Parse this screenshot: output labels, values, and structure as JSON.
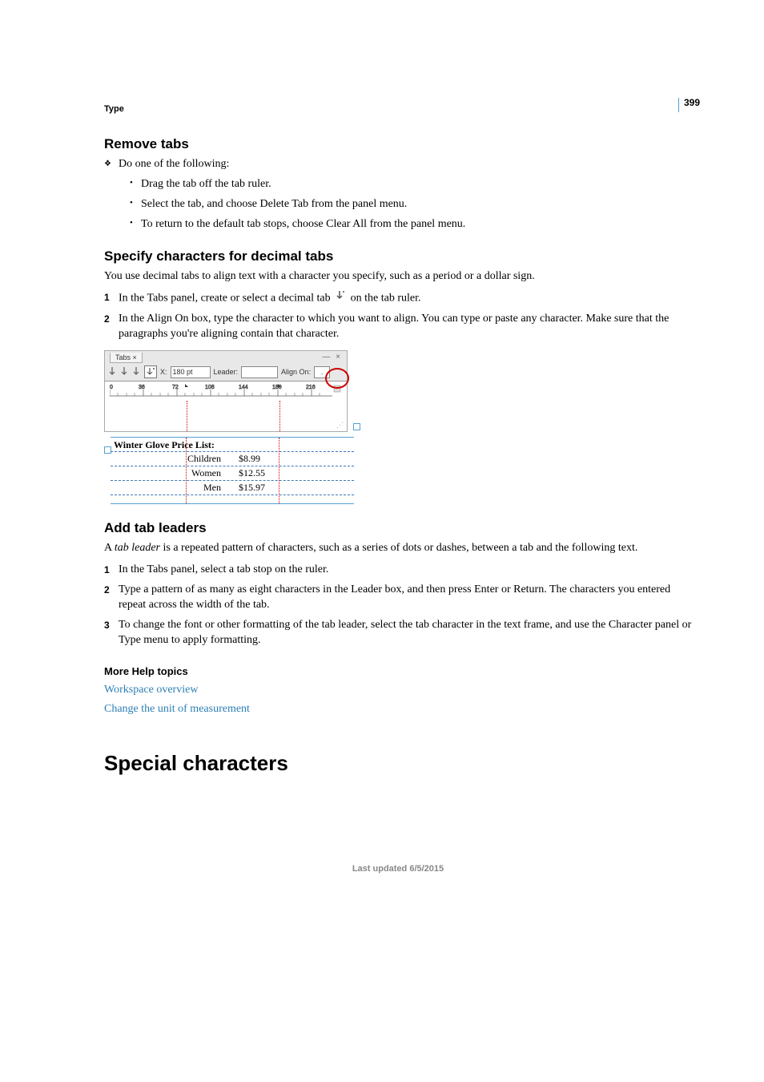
{
  "page_number": "399",
  "chapter": "Type",
  "section_remove": {
    "title": "Remove tabs",
    "intro": "Do one of the following:",
    "bullets": [
      "Drag the tab off the tab ruler.",
      "Select the tab, and choose Delete Tab from the panel menu.",
      "To return to the default tab stops, choose Clear All from the panel menu."
    ]
  },
  "section_decimal": {
    "title": "Specify characters for decimal tabs",
    "intro": "You use decimal tabs to align text with a character you specify, such as a period or a dollar sign.",
    "steps": [
      "In the Tabs panel, create or select a decimal tab",
      "on the tab ruler.",
      "In the Align On box, type the character to which you want to align. You can type or paste any character. Make sure that the paragraphs you're aligning contain that character."
    ],
    "panel": {
      "title": "Tabs",
      "x_label": "X:",
      "x_value": "180 pt",
      "leader_label": "Leader:",
      "leader_value": "",
      "alignon_label": "Align On:",
      "alignon_value": ".",
      "ruler_ticks": [
        "0",
        "36",
        "72",
        "108",
        "144",
        "180",
        "216"
      ]
    },
    "example": {
      "title": "Winter Glove Price List:",
      "rows": [
        {
          "cat": "Children",
          "price": "$8.99"
        },
        {
          "cat": "Women",
          "price": "$12.55"
        },
        {
          "cat": "Men",
          "price": "$15.97"
        }
      ]
    }
  },
  "section_leaders": {
    "title": "Add tab leaders",
    "intro_pre": "A ",
    "intro_italic": "tab leader",
    "intro_post": " is a repeated pattern of characters, such as a series of dots or dashes, between a tab and the following text.",
    "steps": [
      "In the Tabs panel, select a tab stop on the ruler.",
      "Type a pattern of as many as eight characters in the Leader box, and then press Enter or Return. The characters you entered repeat across the width of the tab.",
      "To change the font or other formatting of the tab leader, select the tab character in the text frame, and use the Character panel or Type menu to apply formatting."
    ]
  },
  "more_help": {
    "title": "More Help topics",
    "links": [
      "Workspace overview",
      "Change the unit of measurement"
    ]
  },
  "special_chars_heading": "Special characters",
  "footer": "Last updated 6/5/2015"
}
